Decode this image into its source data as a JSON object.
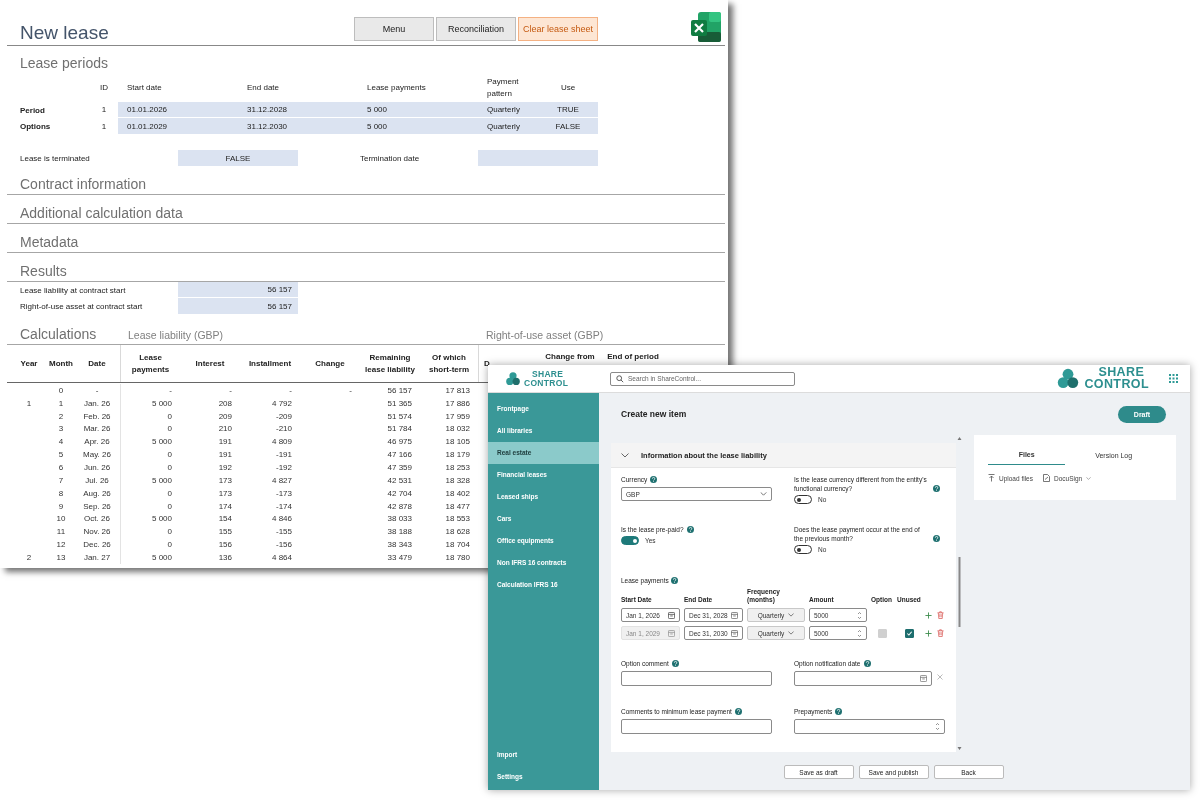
{
  "spreadsheet": {
    "title": "New lease",
    "buttons": [
      {
        "label": "Menu",
        "kind": "plain"
      },
      {
        "label": "Reconciliation",
        "kind": "plain"
      },
      {
        "label": "Clear lease sheet",
        "kind": "warning"
      }
    ],
    "lease_periods": {
      "heading": "Lease periods",
      "columns": [
        "ID",
        "Start date",
        "End date",
        "Lease payments",
        "Payment pattern",
        "Use"
      ],
      "rows": [
        {
          "label": "Period",
          "cells": [
            "1",
            "01.01.2026",
            "31.12.2028",
            "5 000",
            "Quarterly",
            "TRUE"
          ]
        },
        {
          "label": "Options",
          "cells": [
            "1",
            "01.01.2029",
            "31.12.2030",
            "5 000",
            "Quarterly",
            "FALSE"
          ]
        }
      ]
    },
    "termination": {
      "label": "Lease is terminated",
      "value": "FALSE",
      "date_label": "Termination date"
    },
    "sections": [
      "Contract information",
      "Additional calculation data",
      "Metadata"
    ],
    "results": {
      "heading": "Results",
      "rows": [
        {
          "label": "Lease liability at contract start",
          "value": "56 157"
        },
        {
          "label": "Right-of-use asset at contract start",
          "value": "56 157"
        }
      ]
    },
    "calculations": {
      "heading": "Calculations",
      "lease_liability_heading": "Lease liability (GBP)",
      "right_of_use_heading": "Right-of-use asset (GBP)",
      "columns": [
        "Year",
        "Month",
        "Date",
        "Lease payments",
        "Interest",
        "Installment",
        "Change",
        "Remaining lease liability",
        "Of which short-term",
        "D",
        "Change from",
        "End of period"
      ],
      "rows": [
        {
          "month": "0",
          "date": "-",
          "payments": "-",
          "interest": "-",
          "installment": "-",
          "change": "-",
          "remaining": "56 157",
          "short_term": "17 813"
        },
        {
          "year": "1",
          "month": "1",
          "date": "Jan. 26",
          "payments": "5 000",
          "interest": "208",
          "installment": "4 792",
          "remaining": "51 365",
          "short_term": "17 886"
        },
        {
          "month": "2",
          "date": "Feb. 26",
          "payments": "0",
          "interest": "209",
          "installment": "-209",
          "remaining": "51 574",
          "short_term": "17 959"
        },
        {
          "month": "3",
          "date": "Mar. 26",
          "payments": "0",
          "interest": "210",
          "installment": "-210",
          "remaining": "51 784",
          "short_term": "18 032"
        },
        {
          "month": "4",
          "date": "Apr. 26",
          "payments": "5 000",
          "interest": "191",
          "installment": "4 809",
          "remaining": "46 975",
          "short_term": "18 105"
        },
        {
          "month": "5",
          "date": "May. 26",
          "payments": "0",
          "interest": "191",
          "installment": "-191",
          "remaining": "47 166",
          "short_term": "18 179"
        },
        {
          "month": "6",
          "date": "Jun. 26",
          "payments": "0",
          "interest": "192",
          "installment": "-192",
          "remaining": "47 359",
          "short_term": "18 253"
        },
        {
          "month": "7",
          "date": "Jul. 26",
          "payments": "5 000",
          "interest": "173",
          "installment": "4 827",
          "remaining": "42 531",
          "short_term": "18 328"
        },
        {
          "month": "8",
          "date": "Aug. 26",
          "payments": "0",
          "interest": "173",
          "installment": "-173",
          "remaining": "42 704",
          "short_term": "18 402"
        },
        {
          "month": "9",
          "date": "Sep. 26",
          "payments": "0",
          "interest": "174",
          "installment": "-174",
          "remaining": "42 878",
          "short_term": "18 477"
        },
        {
          "month": "10",
          "date": "Oct. 26",
          "payments": "5 000",
          "interest": "154",
          "installment": "4 846",
          "remaining": "38 033",
          "short_term": "18 553"
        },
        {
          "month": "11",
          "date": "Nov. 26",
          "payments": "0",
          "interest": "155",
          "installment": "-155",
          "remaining": "38 188",
          "short_term": "18 628"
        },
        {
          "month": "12",
          "date": "Dec. 26",
          "payments": "0",
          "interest": "156",
          "installment": "-156",
          "remaining": "38 343",
          "short_term": "18 704"
        },
        {
          "year": "2",
          "month": "13",
          "date": "Jan. 27",
          "payments": "5 000",
          "interest": "136",
          "installment": "4 864",
          "remaining": "33 479",
          "short_term": "18 780"
        }
      ]
    }
  },
  "sharecontrol": {
    "logo": {
      "top": "SHARE",
      "bottom": "CONTROL"
    },
    "search": {
      "placeholder": "Search in ShareControl..."
    },
    "header_logo": {
      "top": "SHARE",
      "bottom": "CONTROL"
    },
    "sidebar": {
      "items": [
        {
          "label": "Frontpage",
          "selected": false
        },
        {
          "label": "All libraries",
          "selected": false
        },
        {
          "label": "Real estate",
          "selected": true
        },
        {
          "label": "Financial leases",
          "selected": false
        },
        {
          "label": "Leased ships",
          "selected": false
        },
        {
          "label": "Cars",
          "selected": false
        },
        {
          "label": "Office equipments",
          "selected": false
        },
        {
          "label": "Non IFRS 16 contracts",
          "selected": false
        },
        {
          "label": "Calculation IFRS 16",
          "selected": false
        }
      ],
      "footer_items": [
        {
          "label": "Import",
          "selected": false
        },
        {
          "label": "Settings",
          "selected": false
        }
      ]
    },
    "page_title": "Create new item",
    "status": "Draft",
    "section": {
      "title": "Information about the lease liability",
      "expanded": true
    },
    "fields_before": [
      {
        "kind": "select",
        "label": "Currency",
        "value": "GBP"
      },
      {
        "kind": "toggle",
        "label": "Is the lease currency different from the entity's functional currency?",
        "on": false,
        "state_label": "No"
      },
      {
        "kind": "toggle",
        "label": "Is the lease pre-paid?",
        "on": true,
        "state_label": "Yes"
      },
      {
        "kind": "toggle",
        "label": "Does the lease payment occur at the end of the previous month?",
        "on": false,
        "state_label": "No"
      }
    ],
    "lease_payments": {
      "label": "Lease payments",
      "columns": [
        "Start Date",
        "End Date",
        "Frequency (months)",
        "Amount",
        "Option",
        "Unused"
      ],
      "rows": [
        {
          "start": {
            "value": "Jan 1, 2026",
            "disabled": false
          },
          "end": "Dec 31, 2028",
          "frequency": "Quarterly",
          "amount": "5000"
        },
        {
          "start": {
            "value": "Jan 1, 2029",
            "disabled": true
          },
          "end": "Dec 31, 2030",
          "frequency": "Quarterly",
          "amount": "5000",
          "option": {
            "checked": false,
            "disabled": true
          },
          "unused": {
            "checked": true
          }
        }
      ]
    },
    "fields_after": [
      {
        "kind": "text",
        "label": "Option comment"
      },
      {
        "kind": "date",
        "label": "Option notification date"
      },
      {
        "kind": "text",
        "label": "Comments to minimum lease payment"
      },
      {
        "kind": "number",
        "label": "Prepayments"
      }
    ],
    "side_panel": {
      "tabs": [
        {
          "label": "Files",
          "selected": true
        },
        {
          "label": "Version Log",
          "selected": false
        }
      ],
      "actions": [
        {
          "label": "Upload files",
          "kind": "upload"
        },
        {
          "label": "DocuSign",
          "kind": "docusign"
        }
      ]
    },
    "footer_buttons": [
      "Save as draft",
      "Save and publish",
      "Back"
    ]
  }
}
